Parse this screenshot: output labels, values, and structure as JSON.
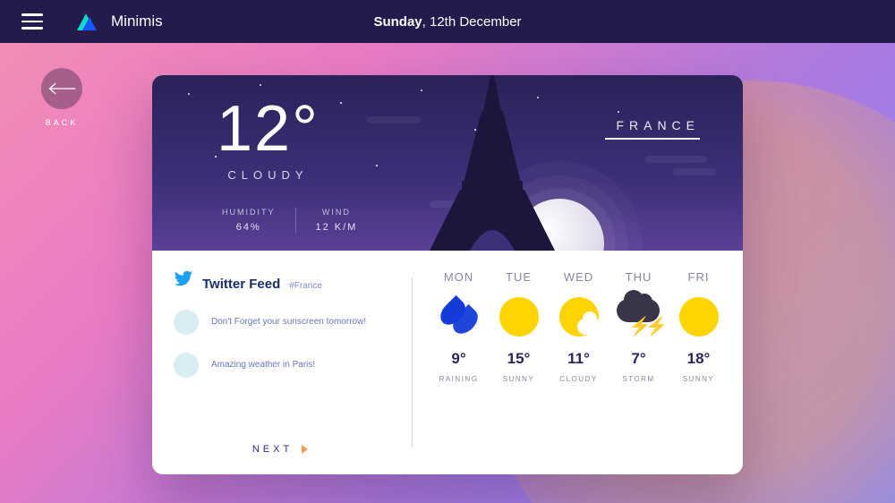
{
  "header": {
    "brand": "Minimis",
    "date_bold": "Sunday",
    "date_rest": ", 12th December"
  },
  "back": {
    "label": "BACK"
  },
  "hero": {
    "temp": "12°",
    "condition": "CLOUDY",
    "humidity_label": "HUMIDITY",
    "humidity_value": "64%",
    "wind_label": "WIND",
    "wind_value": "12 K/M",
    "location": "FRANCE"
  },
  "twitter": {
    "title": "Twitter Feed",
    "hashtag": "#France",
    "tweets": [
      {
        "text": "Don't Forget your sunscreen tomorrow!"
      },
      {
        "text": "Amazing weather in Paris!"
      }
    ],
    "next": "NEXT"
  },
  "forecast": [
    {
      "day": "MON",
      "temp": "9°",
      "cond": "RAINING",
      "icon": "rain"
    },
    {
      "day": "TUE",
      "temp": "15°",
      "cond": "SUNNY",
      "icon": "sun"
    },
    {
      "day": "WED",
      "temp": "11°",
      "cond": "CLOUDY",
      "icon": "cloudy"
    },
    {
      "day": "THU",
      "temp": "7°",
      "cond": "STORM",
      "icon": "storm"
    },
    {
      "day": "FRI",
      "temp": "18°",
      "cond": "SUNNY",
      "icon": "sun"
    }
  ]
}
